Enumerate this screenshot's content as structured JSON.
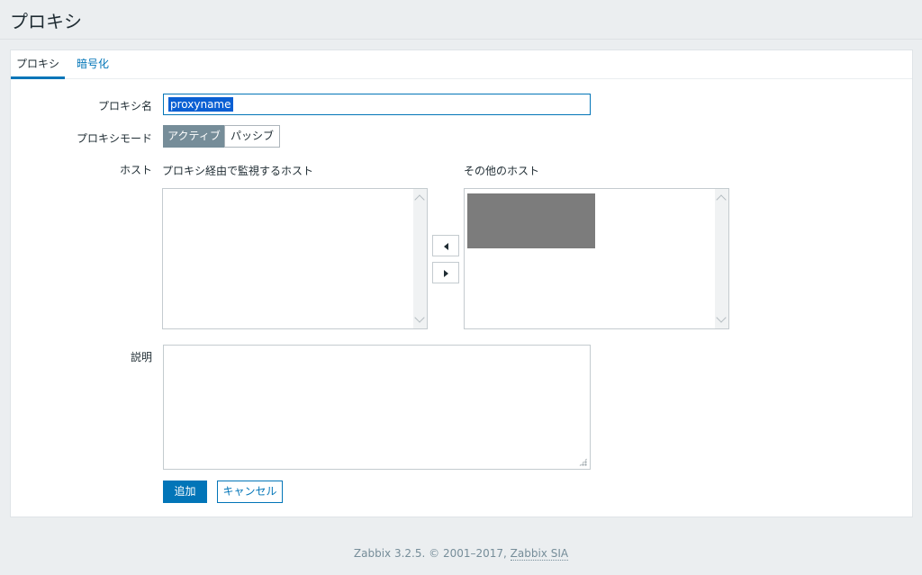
{
  "page": {
    "title": "プロキシ"
  },
  "tabs": [
    {
      "label": "プロキシ",
      "active": true
    },
    {
      "label": "暗号化",
      "active": false
    }
  ],
  "form": {
    "proxy_name": {
      "label": "プロキシ名",
      "value": "proxyname"
    },
    "proxy_mode": {
      "label": "プロキシモード",
      "options": [
        "アクティブ",
        "パッシブ"
      ],
      "selected": "アクティブ"
    },
    "hosts": {
      "label": "ホスト",
      "monitored_label": "プロキシ経由で監視するホスト",
      "other_label": "その他のホスト",
      "monitored_items": [],
      "other_items_redacted": true
    },
    "description": {
      "label": "説明",
      "value": ""
    }
  },
  "buttons": {
    "add": "追加",
    "cancel": "キャンセル"
  },
  "footer": {
    "text": "Zabbix 3.2.5. © 2001–2017, ",
    "link": "Zabbix SIA"
  },
  "colors": {
    "accent": "#0275b8",
    "segment_active": "#768d99",
    "background": "#ebeef0"
  }
}
